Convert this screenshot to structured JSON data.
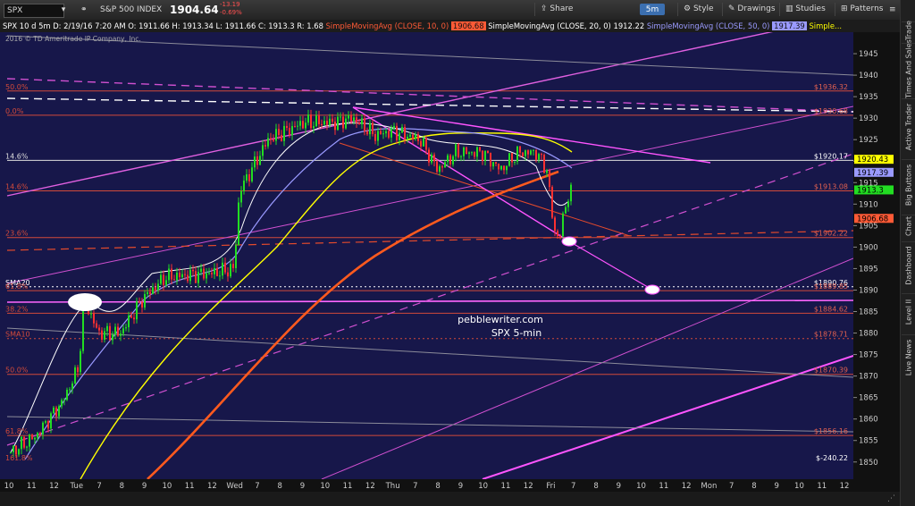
{
  "toolbar": {
    "symbol": "SPX",
    "index_name": "S&P 500 INDEX",
    "price": "1904.64",
    "change": "-13.19",
    "change_pct": "-0.69%",
    "share_label": "Share",
    "interval": "5m",
    "style_label": "Style",
    "drawings_label": "Drawings",
    "studies_label": "Studies",
    "patterns_label": "Patterns"
  },
  "infobar": {
    "symbol": "SPX 10 d 5m",
    "ohlc": "D: 2/19/16 7:20 AM   O: 1911.66   H: 1913.34   L: 1911.66   C: 1913.3   R: 1.68",
    "sma10_label": "SimpleMovingAvg (CLOSE, 10, 0)",
    "sma10_value": "1906.68",
    "sma20_label": "SimpleMovingAvg (CLOSE, 20, 0)",
    "sma20_value": "1912.22",
    "sma50_label": "SimpleMovingAvg (CLOSE, 50, 0)",
    "sma50_value": "1917.39",
    "more": "Simple..."
  },
  "copyright": "2016 © TD Ameritrade IP Company, Inc.",
  "watermark": {
    "line1": "pebblewriter.com",
    "line2": "SPX 5-min"
  },
  "right_tabs": [
    "Trade",
    "Times And Sales",
    "Active Trader",
    "Big Buttons",
    "Chart",
    "Dashboard",
    "Level II",
    "Live News"
  ],
  "chart_data": {
    "type": "candlestick",
    "ylim": [
      1846,
      1950
    ],
    "y_ticks": [
      1850,
      1855,
      1860,
      1865,
      1870,
      1875,
      1880,
      1885,
      1890,
      1895,
      1900,
      1905,
      1910,
      1915,
      1920,
      1925,
      1930,
      1935,
      1940,
      1945
    ],
    "x_ticks": [
      "10",
      "11",
      "12",
      "Tue",
      "7",
      "8",
      "9",
      "10",
      "11",
      "12",
      "Wed",
      "7",
      "8",
      "9",
      "10",
      "11",
      "12",
      "Thu",
      "7",
      "8",
      "9",
      "10",
      "11",
      "12",
      "Fri",
      "7",
      "8",
      "9",
      "10",
      "11",
      "12",
      "Mon",
      "7",
      "8",
      "9",
      "10",
      "11",
      "12"
    ],
    "price_tags": [
      {
        "text": "1920.43",
        "value": 1920.43,
        "color": "#ffff00"
      },
      {
        "text": "1917.39",
        "value": 1917.39,
        "color": "#9a9aff"
      },
      {
        "text": "1913.3",
        "value": 1913.3,
        "color": "#22dd22"
      },
      {
        "text": "1906.68",
        "value": 1906.68,
        "color": "#ff5a36"
      }
    ],
    "levels": [
      {
        "label": "50.0%",
        "value": 1936.32,
        "right_text": "$1936.32",
        "color": "#d24a3a",
        "style": "solid",
        "right_color": "#e06050"
      },
      {
        "label": "0.0%",
        "value": 1930.68,
        "right_text": "$1930.68",
        "color": "#d24a3a",
        "style": "solid",
        "right_color": "#e06050"
      },
      {
        "label": "14.6%",
        "value": 1920.17,
        "right_text": "$1920.17",
        "color": "#dddddd",
        "style": "solid",
        "right_color": "#ffffff"
      },
      {
        "label": "14.6%",
        "value": 1913.08,
        "right_text": "$1913.08",
        "color": "#d24a3a",
        "style": "solid",
        "right_color": "#e06050"
      },
      {
        "label": "23.6%",
        "value": 1902.22,
        "right_text": "$1902.22",
        "color": "#d24a3a",
        "style": "solid",
        "right_color": "#e06050"
      },
      {
        "label": "SMA20",
        "value": 1890.76,
        "right_text": "$1890.76",
        "color": "#ffffff",
        "style": "dotted",
        "right_color": "#ffffff"
      },
      {
        "label": "61.8%",
        "value": 1889.85,
        "right_text": "$1889.85",
        "color": "#d24a3a",
        "style": "solid",
        "right_color": "#e06050"
      },
      {
        "label": "38.2%",
        "value": 1884.62,
        "right_text": "$1884.62",
        "color": "#d24a3a",
        "style": "solid",
        "right_color": "#e06050"
      },
      {
        "label": "SMA10",
        "value": 1878.71,
        "right_text": "$1878.71",
        "color": "#d24a3a",
        "style": "dotted",
        "right_color": "#e06050"
      },
      {
        "label": "50.0%",
        "value": 1870.39,
        "right_text": "$1870.39",
        "color": "#d24a3a",
        "style": "solid",
        "right_color": "#e06050"
      },
      {
        "label": "61.8%",
        "value": 1856.16,
        "right_text": "$1856.16",
        "color": "#d24a3a",
        "style": "solid",
        "right_color": "#e06050"
      },
      {
        "label": "161.8%",
        "value": 1850,
        "right_text": "$-240.22",
        "color": "#d24a3a",
        "style": "none",
        "right_color": "#ffffff"
      }
    ],
    "series": [
      {
        "name": "SMA 10",
        "color": "#ffffff"
      },
      {
        "name": "SMA 20",
        "color": "#9a9aff"
      },
      {
        "name": "SMA 50",
        "color": "#ffff00"
      },
      {
        "name": "SMA 200",
        "color": "#ff5a1e"
      }
    ]
  }
}
